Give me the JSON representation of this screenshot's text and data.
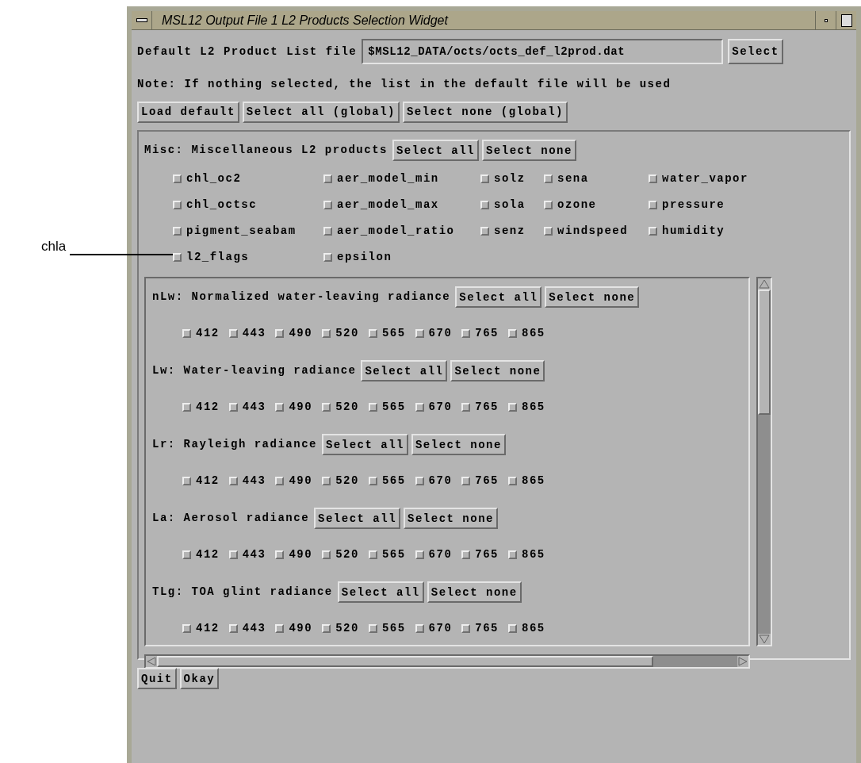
{
  "annotation": {
    "label": "chla"
  },
  "window": {
    "title": "MSL12 Output File 1 L2 Products Selection Widget"
  },
  "default_file": {
    "label": "Default L2 Product List file",
    "value": "$MSL12_DATA/octs/octs_def_l2prod.dat",
    "button": "Select"
  },
  "note": "Note: If nothing selected, the list in the default file will be used",
  "global_buttons": [
    "Load default",
    "Select all (global)",
    "Select none (global)"
  ],
  "misc": {
    "title": "Misc: Miscellaneous L2 products",
    "buttons": [
      "Select all",
      "Select none"
    ],
    "products": [
      {
        "label": "chl_oc2",
        "checked": false
      },
      {
        "label": "aer_model_min",
        "checked": false
      },
      {
        "label": "solz",
        "checked": false
      },
      {
        "label": "sena",
        "checked": false
      },
      {
        "label": "water_vapor",
        "checked": false
      },
      {
        "label": "chl_octsc",
        "checked": false
      },
      {
        "label": "aer_model_max",
        "checked": false
      },
      {
        "label": "sola",
        "checked": false
      },
      {
        "label": "ozone",
        "checked": false
      },
      {
        "label": "pressure",
        "checked": false
      },
      {
        "label": "pigment_seabam",
        "checked": false
      },
      {
        "label": "aer_model_ratio",
        "checked": false
      },
      {
        "label": "senz",
        "checked": false
      },
      {
        "label": "windspeed",
        "checked": false
      },
      {
        "label": "humidity",
        "checked": false
      },
      {
        "label": "l2_flags",
        "checked": false
      },
      {
        "label": "epsilon",
        "checked": false
      }
    ]
  },
  "band_groups": [
    {
      "title": "nLw: Normalized water-leaving radiance",
      "buttons": [
        "Select all",
        "Select none"
      ],
      "bands": [
        {
          "label": "412",
          "checked": false
        },
        {
          "label": "443",
          "checked": false
        },
        {
          "label": "490",
          "checked": false
        },
        {
          "label": "520",
          "checked": false
        },
        {
          "label": "565",
          "checked": false
        },
        {
          "label": "670",
          "checked": false
        },
        {
          "label": "765",
          "checked": false
        },
        {
          "label": "865",
          "checked": false
        }
      ]
    },
    {
      "title": "Lw: Water-leaving radiance",
      "buttons": [
        "Select all",
        "Select none"
      ],
      "bands": [
        {
          "label": "412",
          "checked": false
        },
        {
          "label": "443",
          "checked": false
        },
        {
          "label": "490",
          "checked": false
        },
        {
          "label": "520",
          "checked": false
        },
        {
          "label": "565",
          "checked": false
        },
        {
          "label": "670",
          "checked": false
        },
        {
          "label": "765",
          "checked": false
        },
        {
          "label": "865",
          "checked": false
        }
      ]
    },
    {
      "title": "Lr: Rayleigh radiance",
      "buttons": [
        "Select all",
        "Select none"
      ],
      "bands": [
        {
          "label": "412",
          "checked": false
        },
        {
          "label": "443",
          "checked": false
        },
        {
          "label": "490",
          "checked": false
        },
        {
          "label": "520",
          "checked": false
        },
        {
          "label": "565",
          "checked": false
        },
        {
          "label": "670",
          "checked": false
        },
        {
          "label": "765",
          "checked": false
        },
        {
          "label": "865",
          "checked": false
        }
      ]
    },
    {
      "title": "La: Aerosol radiance",
      "buttons": [
        "Select all",
        "Select none"
      ],
      "bands": [
        {
          "label": "412",
          "checked": false
        },
        {
          "label": "443",
          "checked": false
        },
        {
          "label": "490",
          "checked": false
        },
        {
          "label": "520",
          "checked": false
        },
        {
          "label": "565",
          "checked": false
        },
        {
          "label": "670",
          "checked": false
        },
        {
          "label": "765",
          "checked": false
        },
        {
          "label": "865",
          "checked": false
        }
      ]
    },
    {
      "title": "TLg: TOA glint radiance",
      "buttons": [
        "Select all",
        "Select none"
      ],
      "bands": [
        {
          "label": "412",
          "checked": false
        },
        {
          "label": "443",
          "checked": false
        },
        {
          "label": "490",
          "checked": false
        },
        {
          "label": "520",
          "checked": false
        },
        {
          "label": "565",
          "checked": false
        },
        {
          "label": "670",
          "checked": false
        },
        {
          "label": "765",
          "checked": false
        },
        {
          "label": "865",
          "checked": false
        }
      ]
    }
  ],
  "bottom_buttons": [
    "Quit",
    "Okay"
  ]
}
